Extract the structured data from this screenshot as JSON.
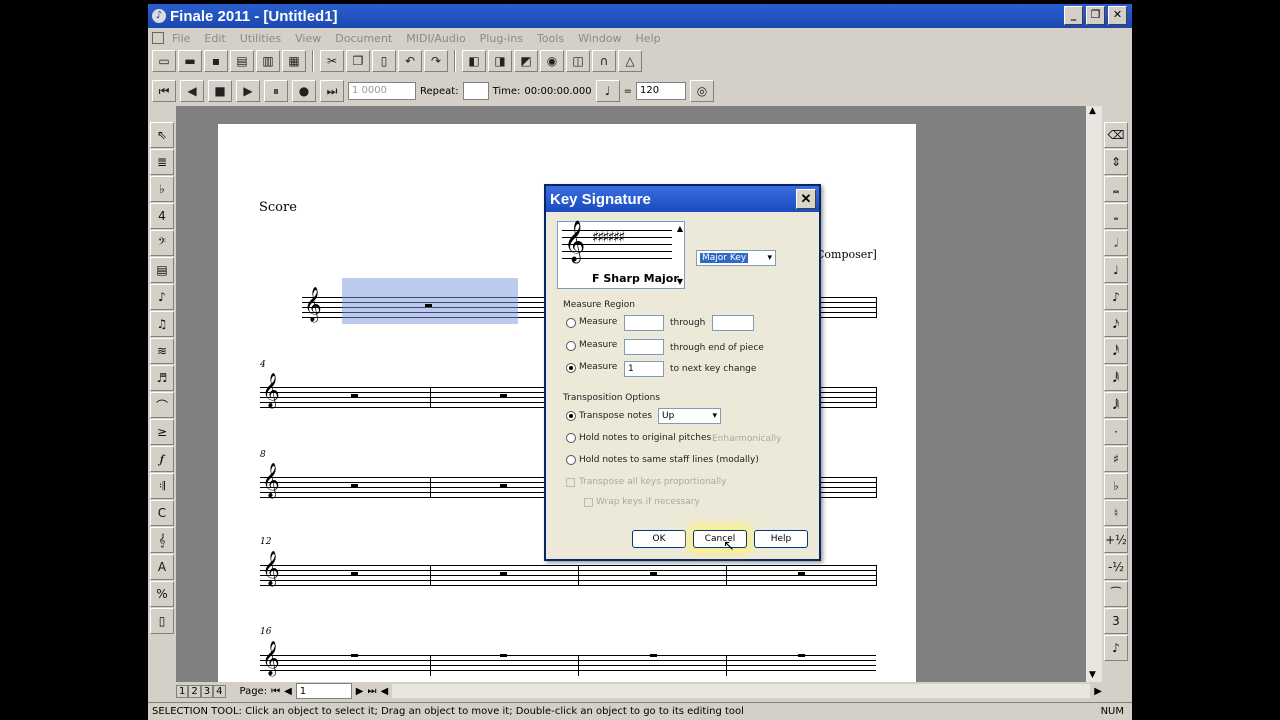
{
  "window": {
    "title": "Finale 2011 - [Untitled1]"
  },
  "menubar": [
    "File",
    "Edit",
    "Utilities",
    "View",
    "Document",
    "MIDI/Audio",
    "Plug-ins",
    "Tools",
    "Window",
    "Help"
  ],
  "playback": {
    "measure_value": "1 0000",
    "repeat_label": "Repeat:",
    "time_label": "Time:",
    "time_value": "00:00:00.000",
    "equals": "=",
    "tempo": "120"
  },
  "score": {
    "title_label": "Score",
    "composer_label": "Composer]",
    "measure_numbers": [
      "4",
      "8",
      "12",
      "16"
    ]
  },
  "dialog": {
    "title": "Key Signature",
    "key_preview_label": "F Sharp Major",
    "mode_select": "Major Key",
    "measure_region_label": "Measure Region",
    "measure_label": "Measure",
    "through_label": "through",
    "through_end_label": "through end of piece",
    "measure_value": "1",
    "to_next_label": "to next key change",
    "transposition_label": "Transposition Options",
    "transpose_notes_label": "Transpose notes",
    "direction_select": "Up",
    "hold_original_label": "Hold notes to original pitches",
    "enharmonically_label": "Enharmonically",
    "hold_same_label": "Hold notes to same staff lines (modally)",
    "transpose_all_label": "Transpose all keys proportionally",
    "wrap_label": "Wrap keys if necessary",
    "ok_label": "OK",
    "cancel_label": "Cancel",
    "help_label": "Help"
  },
  "nav": {
    "page_label": "Page:",
    "page_value": "1",
    "tabs": [
      "1",
      "2",
      "3",
      "4"
    ]
  },
  "status": {
    "text": "SELECTION TOOL: Click an object to select it; Drag an object to move it; Double-click an object to go to its editing tool",
    "num": "NUM"
  }
}
